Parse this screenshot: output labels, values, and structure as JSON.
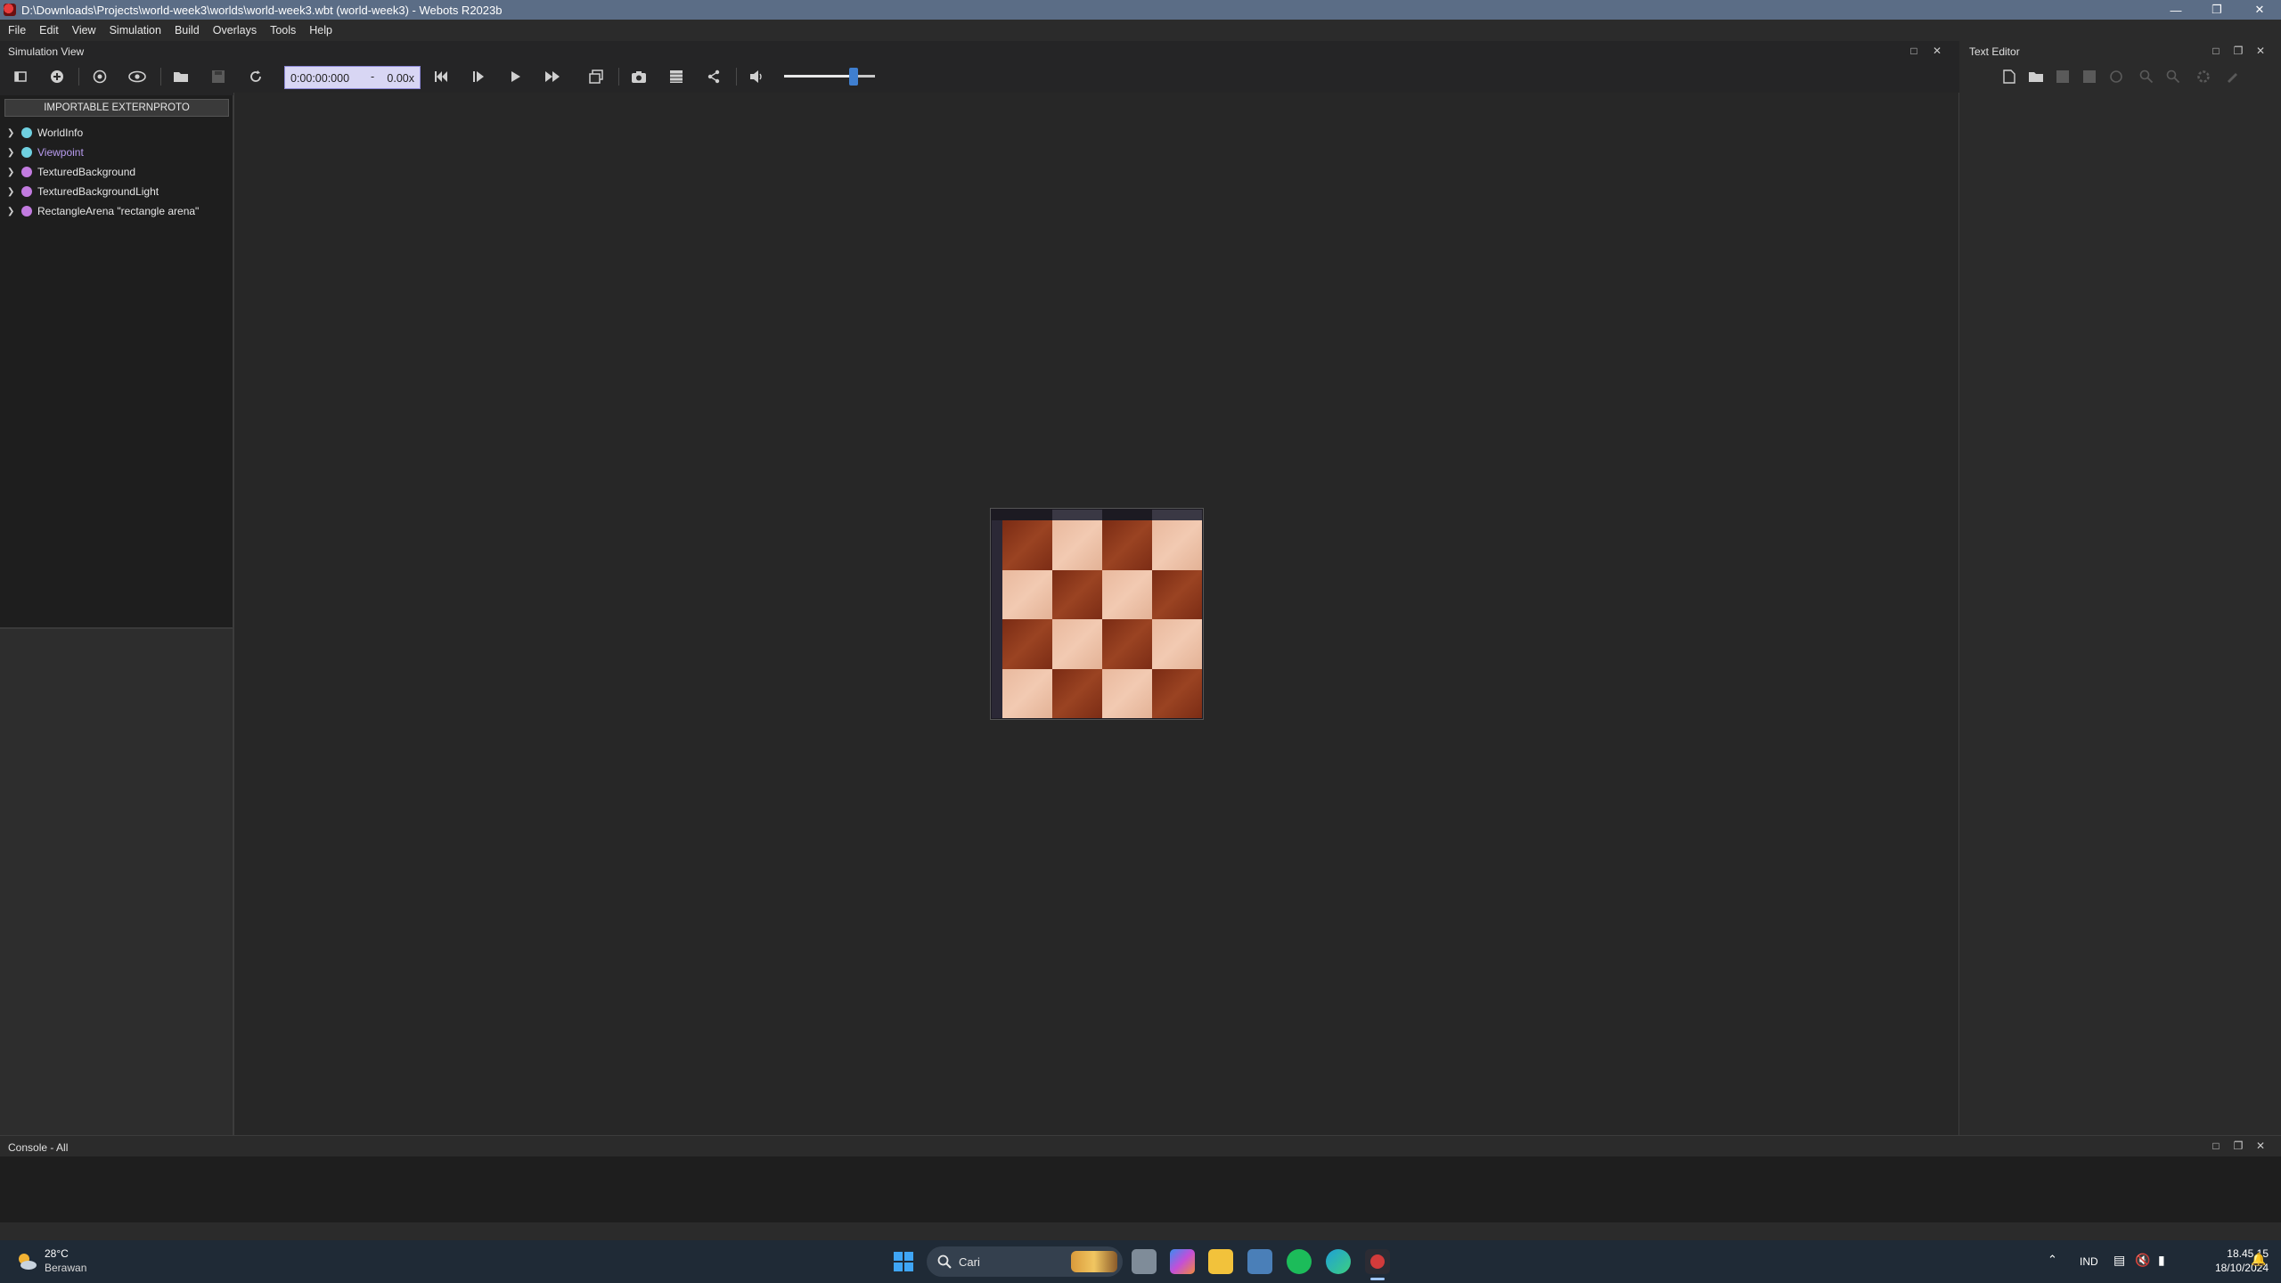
{
  "window": {
    "title": "D:\\Downloads\\Projects\\world-week3\\worlds\\world-week3.wbt (world-week3) - Webots R2023b"
  },
  "menu": [
    "File",
    "Edit",
    "View",
    "Simulation",
    "Build",
    "Overlays",
    "Tools",
    "Help"
  ],
  "simulation_view": {
    "title": "Simulation View",
    "time": "0:00:00:000",
    "dash": "-",
    "speed": "0.00x",
    "volume_level": 0.77
  },
  "scene_tree": {
    "extern_button": "IMPORTABLE EXTERNPROTO",
    "nodes": [
      {
        "label": "WorldInfo",
        "color": "#6fd0e0",
        "text_color": "#e6e6e6"
      },
      {
        "label": "Viewpoint",
        "color": "#6fd0e0",
        "text_color": "#b99cf0"
      },
      {
        "label": "TexturedBackground",
        "color": "#c27be0",
        "text_color": "#e6e6e6"
      },
      {
        "label": "TexturedBackgroundLight",
        "color": "#c27be0",
        "text_color": "#e6e6e6"
      },
      {
        "label": "RectangleArena \"rectangle arena\"",
        "color": "#c27be0",
        "text_color": "#e6e6e6"
      }
    ]
  },
  "text_editor": {
    "title": "Text Editor"
  },
  "console": {
    "title": "Console - All"
  },
  "taskbar": {
    "weather_temp": "28°C",
    "weather_desc": "Berawan",
    "search_placeholder": "Cari",
    "language": "IND",
    "time": "18.45.15",
    "date": "18/10/2024"
  }
}
